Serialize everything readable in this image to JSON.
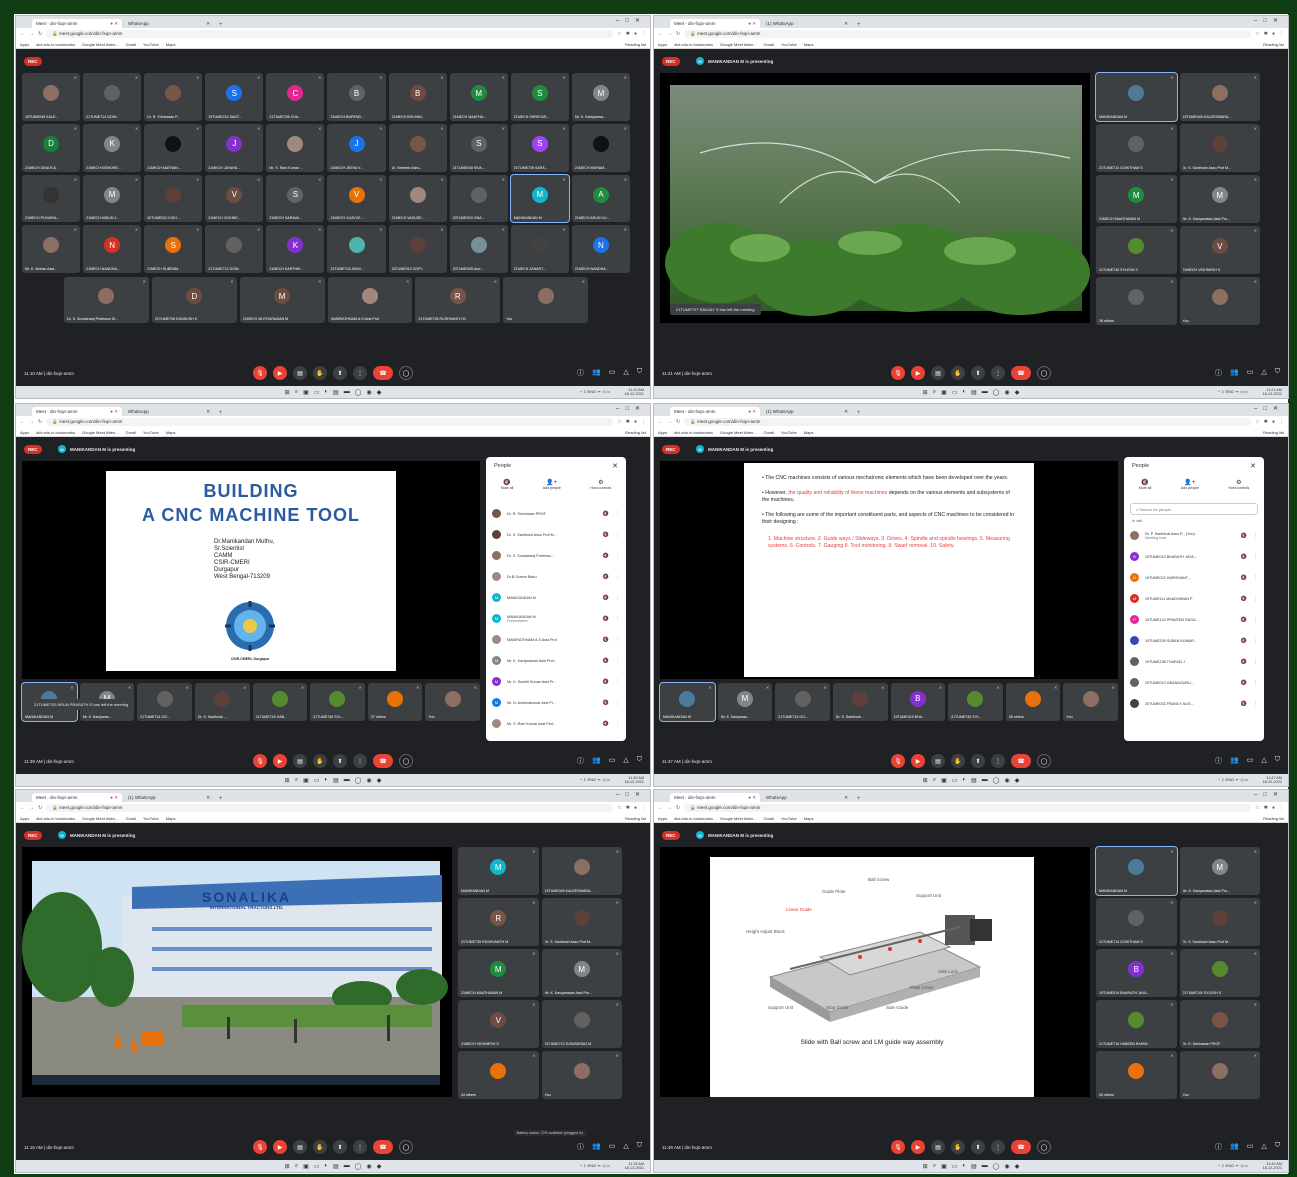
{
  "browser": {
    "tab_meet": "Meet - din-fxqn-amm",
    "tab_whatsapp": "WhatsApp",
    "tab_whatsapp_count": "(1) WhatsApp",
    "url": "meet.google.com/din-fxqn-amm",
    "bookmarks": [
      "Apps",
      "dict.edu.in bookmarks",
      "Google Meet Atten...",
      "Gmail",
      "YouTube",
      "Maps"
    ],
    "reading_list": "Reading list"
  },
  "meet": {
    "rec": "REC",
    "meeting_code": "din-fxqn-amm",
    "presenting": "MANIKANDAN M is presenting"
  },
  "panel1": {
    "time": "11:10 AM",
    "clock_time": "11:10 AM",
    "clock_date": "18-12-2021",
    "tiles": [
      {
        "n": "19TUME045 KALE...",
        "i": "",
        "c": "#8d6e63"
      },
      {
        "n": "21TUME714 GOW...",
        "i": "",
        "c": "#616161"
      },
      {
        "n": "Dr. R. Srinivasan P...",
        "i": "",
        "c": "#795548"
      },
      {
        "n": "19TUME210 SANT...",
        "i": "S",
        "c": "#1a73e8"
      },
      {
        "n": "21TUME706 CHA...",
        "i": "C",
        "c": "#e52592"
      },
      {
        "n": "21MECH BUPEND...",
        "i": "B",
        "c": "#5f6368"
      },
      {
        "n": "21MECH BHUVAN...",
        "i": "B",
        "c": "#6d4c41"
      },
      {
        "n": "21MECH MAATHA...",
        "i": "M",
        "c": "#1e8e3e"
      },
      {
        "n": "21MECH SHREYAS...",
        "i": "S",
        "c": "#1e8e3e"
      },
      {
        "n": "Mr. K. Kaviyarasa...",
        "i": "M",
        "c": "#80868b"
      },
      {
        "n": "21MECH DINA R.A.",
        "i": "D",
        "c": "#188038"
      },
      {
        "n": "21MECH KISHORE...",
        "i": "K",
        "c": "#80868b"
      },
      {
        "n": "21MECH MATHAN...",
        "i": "",
        "c": "#111"
      },
      {
        "n": "21MECH JAYAHA...",
        "i": "J",
        "c": "#8430ce"
      },
      {
        "n": "Mr. S. Ram Kumar ...",
        "i": "",
        "c": "#a1887f"
      },
      {
        "n": "21MECH JEEVA V...",
        "i": "J",
        "c": "#1a73e8"
      },
      {
        "n": "Dr. Neelesh Ashu...",
        "i": "",
        "c": "#795548"
      },
      {
        "n": "21TUME040 SIVA...",
        "i": "S",
        "c": "#5f6368"
      },
      {
        "n": "21TUME739 SARA...",
        "i": "S",
        "c": "#a142f4"
      },
      {
        "n": "21MECH MOHAM...",
        "i": "",
        "c": "#111"
      },
      {
        "n": "21MECH PUVIARA...",
        "i": "",
        "c": "#333"
      },
      {
        "n": "21MECH MIDUN J...",
        "i": "M",
        "c": "#80868b"
      },
      {
        "n": "20TUME022 KISH...",
        "i": "",
        "c": "#5d4037"
      },
      {
        "n": "21MECH VIGHNE...",
        "i": "V",
        "c": "#6d4c41"
      },
      {
        "n": "21MECH SARAVA...",
        "i": "S",
        "c": "#5f6368"
      },
      {
        "n": "21MECH VIJAYVE...",
        "i": "V",
        "c": "#e8710a"
      },
      {
        "n": "21MECH VASUDE...",
        "i": "",
        "c": "#a1887f"
      },
      {
        "n": "20TUME010 GNA...",
        "i": "",
        "c": "#616161"
      },
      {
        "n": "MANIKANDAN M",
        "i": "M",
        "c": "#12b5cb",
        "hl": true
      },
      {
        "n": "21MECH ARUN KU...",
        "i": "A",
        "c": "#1e8e3e"
      },
      {
        "n": "Mr. K. Mohan Asst...",
        "i": "",
        "c": "#8d6e63"
      },
      {
        "n": "21MECH NANDHA...",
        "i": "N",
        "c": "#d93025"
      },
      {
        "n": "21MECH SUBRAM...",
        "i": "S",
        "c": "#e8710a"
      },
      {
        "n": "21TUME713 GOW...",
        "i": "",
        "c": "#616161"
      },
      {
        "n": "21MECH KARTHIK...",
        "i": "K",
        "c": "#8430ce"
      },
      {
        "n": "21TUME704 ASWI...",
        "i": "",
        "c": "#4db6ac"
      },
      {
        "n": "20TUME010 GOPI...",
        "i": "",
        "c": "#5d4037"
      },
      {
        "n": "20TUME005 Asvi...",
        "i": "",
        "c": "#78909c"
      },
      {
        "n": "21MECH JANART...",
        "i": "",
        "c": "#424242"
      },
      {
        "n": "21MECH NANDHA...",
        "i": "N",
        "c": "#1a73e8"
      }
    ],
    "tiles_last": [
      {
        "n": "Dr. S. Sundararaj Professor M...",
        "i": "",
        "c": "#8d6e63"
      },
      {
        "n": "21TUME708 DHANUSH K",
        "i": "D",
        "c": "#6d4c41"
      },
      {
        "n": "21MECH MUTHURAMAN M",
        "i": "M",
        "c": "#6d4c41"
      },
      {
        "n": "MANIRATHNAM A.S Asst.Prof",
        "i": "",
        "c": "#a1887f"
      },
      {
        "n": "21TUME735 RUSHVANTH M",
        "i": "R",
        "c": "#795548"
      },
      {
        "n": "You",
        "i": "",
        "c": "#8d6e63"
      }
    ]
  },
  "panel2": {
    "time": "11:21 AM",
    "clock_time": "11:21 AM",
    "clock_date": "18-12-2021",
    "notice": "21TUME707 SANJAY S has left the meeting",
    "tiles": [
      {
        "n": "MANIKANDAN M",
        "i": "",
        "c": "#4e7a9a",
        "hl": true
      },
      {
        "n": "19TUME045 KALEESWARA...",
        "i": "",
        "c": "#8d6e63"
      },
      {
        "n": "21TUME714 GOWTHAM S",
        "i": "",
        "c": "#616161"
      },
      {
        "n": "Dr. S. Santhosh Asso Prof M...",
        "i": "",
        "c": "#5d4037"
      },
      {
        "n": "21MECH MAATHAVAN M",
        "i": "M",
        "c": "#1e8e3e"
      },
      {
        "n": "Mr. K. Kaviyarasan Asst Pro...",
        "i": "M",
        "c": "#80868b"
      },
      {
        "n": "21TUME745 SYLESH S",
        "i": "",
        "c": "#558b2f"
      },
      {
        "n": "21MECH VIGHNESH S",
        "i": "V",
        "c": "#6d4c41"
      },
      {
        "n": "26 others",
        "i": "",
        "c": "#5f6368"
      },
      {
        "n": "You",
        "i": "",
        "c": "#8d6e63"
      }
    ]
  },
  "panel3": {
    "time": "11:39 AM",
    "clock_time": "11:39 AM",
    "clock_date": "18-12-2021",
    "slide_title1": "BUILDING",
    "slide_title2": "A CNC MACHINE TOOL",
    "author": [
      "Dr.Manikandan Muthu,",
      "Sr.Scientist",
      "CAMM",
      "CSIR-CMERI",
      "Durgapur",
      "West Bengal-713209"
    ],
    "logo_caption": "CSIR-CMERI, Durgapur",
    "notice": "21TUME703 ARUN PRASATH S has left the meeting",
    "people_title": "People",
    "mute_all": "Mute all",
    "add_people": "Add people",
    "host_controls": "Host controls",
    "people": [
      {
        "n": "Dr. R. Srinivasan PROF",
        "c": "#795548"
      },
      {
        "n": "Dr. S. Santhosh Asso Prof M...",
        "c": "#5d4037"
      },
      {
        "n": "Dr. S. Sundararaj Professo...",
        "c": "#8d6e63"
      },
      {
        "n": "Dr.B.Suresh Babu",
        "c": "#a1887f"
      },
      {
        "n": "MANIKANDAN M",
        "c": "#12b5cb",
        "i": "M"
      },
      {
        "n": "MANIKANDAN M",
        "c": "#12b5cb",
        "i": "M",
        "sub": "Presentation"
      },
      {
        "n": "MANIRATHNAM A.S Asst.Prof",
        "c": "#a1887f"
      },
      {
        "n": "Mr. K. Kaviyarasan Asst Prof...",
        "c": "#80868b",
        "i": "M"
      },
      {
        "n": "Mr. K. Senthil Kumar Asst Pr...",
        "c": "#8430ce",
        "i": "M"
      },
      {
        "n": "Mr. N. Aravindkumar Asst Pr...",
        "c": "#1a73e8",
        "i": "M"
      },
      {
        "n": "Mr. S. Ram Kumar Asst Prof...",
        "c": "#a1887f"
      }
    ],
    "tiles": [
      {
        "n": "MANIKANDAN M",
        "i": "",
        "c": "#4e7a9a",
        "hl": true
      },
      {
        "n": "Mr. K. Kaviyaras...",
        "i": "M",
        "c": "#80868b"
      },
      {
        "n": "21TUME714 GO...",
        "i": "",
        "c": "#616161"
      },
      {
        "n": "Dr. S. Santhosh ...",
        "i": "",
        "c": "#5d4037"
      },
      {
        "n": "21TUME716 HAB...",
        "i": "",
        "c": "#558b2f"
      },
      {
        "n": "21TUME745 SYL...",
        "i": "",
        "c": "#558b2f"
      },
      {
        "n": "37 others",
        "i": "",
        "c": "#e8710a"
      },
      {
        "n": "You",
        "i": "",
        "c": "#8d6e63"
      }
    ]
  },
  "panel4": {
    "time": "11:47 AM",
    "clock_time": "11:47 AM",
    "clock_date": "18-12-2021",
    "bullet1": "The CNC machines consists of various mechatronic elements which have been developed over the years.",
    "bullet2a": "However, ",
    "bullet2b": "the quality and reliability of these machines",
    "bullet2c": " depends on the various elements and subsystems of the machines,",
    "bullet3": "The following are some of the important constituent parts, and aspects of CNC machines to be considered in their designing :",
    "parts": "1. Machine structure. 2. Guide ways / Slideways. 3. Drives. 4. Spindle and spindle bearings. 5. Measuring systems. 6. Controls. 7. Gauging 8. Tool monitoring. 9. Swarf removal. 10. Safety.",
    "people_title": "People",
    "mute_all": "Mute all",
    "add_people": "Add people",
    "host_controls": "Host controls",
    "search": "Search for people",
    "in_call": "In call",
    "people": [
      {
        "n": "Dr. P. Santhival Asso P... (You)",
        "c": "#8d6e63",
        "sub": "Meeting host"
      },
      {
        "n": "19TUME019 BHARATH JAYA...",
        "c": "#8430ce",
        "i": "B"
      },
      {
        "n": "19TUME022 HARISHANT...",
        "c": "#e8710a",
        "i": "H"
      },
      {
        "n": "19TUME111 MAADHAVAN P",
        "c": "#d93025",
        "i": "M"
      },
      {
        "n": "19TUME144 PRAVEEN RAGA...",
        "c": "#e52592",
        "i": "P"
      },
      {
        "n": "19TUME209 SUBAN KUMAR...",
        "c": "#3949ab",
        "i": ""
      },
      {
        "n": "19TUME238 THARUN J",
        "c": "#5f6368",
        "i": ""
      },
      {
        "n": "20TUME013 GNANAGURU...",
        "c": "#616161",
        "i": ""
      },
      {
        "n": "20TUME033 FRANCY AUG...",
        "c": "#424242",
        "i": ""
      }
    ],
    "tiles": [
      {
        "n": "MANIKANDAN M",
        "i": "",
        "c": "#4e7a9a",
        "hl": true
      },
      {
        "n": "Mr. K. Kaviyaras...",
        "i": "M",
        "c": "#80868b"
      },
      {
        "n": "21TUME714 GO...",
        "i": "",
        "c": "#616161"
      },
      {
        "n": "Dr. S. Santhosh ...",
        "i": "",
        "c": "#5d4037"
      },
      {
        "n": "19TUME019 BHA...",
        "i": "B",
        "c": "#8430ce"
      },
      {
        "n": "21TUME745 SYL...",
        "i": "",
        "c": "#558b2f"
      },
      {
        "n": "28 others",
        "i": "",
        "c": "#e8710a"
      },
      {
        "n": "You",
        "i": "",
        "c": "#8d6e63"
      }
    ]
  },
  "panel5": {
    "time": "11:15 AM",
    "clock_time": "11:15 AM",
    "clock_date": "18-12-2021",
    "sign_brand": "SONALIKA",
    "sign_sub": "INTERNATIONAL TRACTORS LTD.",
    "battery": "Battery status: 72% available (plugged in)",
    "tiles": [
      {
        "n": "MANIKANDAN M",
        "i": "M",
        "c": "#12b5cb"
      },
      {
        "n": "19TUME045 KALEESWARA...",
        "i": "",
        "c": "#8d6e63"
      },
      {
        "n": "21TUME735 RUSHVANTH M",
        "i": "R",
        "c": "#795548"
      },
      {
        "n": "Dr. S. Santhosh Asso Prof M...",
        "i": "",
        "c": "#5d4037"
      },
      {
        "n": "21MECH MAATHAVAN M",
        "i": "M",
        "c": "#1e8e3e"
      },
      {
        "n": "Mr. K. Kaviyarasan Asst Pro...",
        "i": "M",
        "c": "#80868b"
      },
      {
        "n": "21MECH VIGHNESH S",
        "i": "V",
        "c": "#6d4c41"
      },
      {
        "n": "21TUME710 GOWSIKRAJ M",
        "i": "",
        "c": "#616161"
      },
      {
        "n": "44 others",
        "i": "",
        "c": "#e8710a"
      },
      {
        "n": "You",
        "i": "",
        "c": "#8d6e63"
      }
    ]
  },
  "panel6": {
    "time": "11:49 AM",
    "clock_time": "11:49 AM",
    "clock_date": "18-12-2021",
    "caption": "Slide with Ball screw and LM guide way assembly",
    "labels": {
      "ball_screw": "Ball Screw",
      "guide_plate": "Guide Plate",
      "support_unit_top": "Support Unit",
      "linear_guide": "Linear Guide",
      "height_adjust": "Height Adjust Block",
      "side_lock": "Side Lock",
      "plate_cover": "Plate Cover",
      "support_unit": "Support Unit",
      "stop_guide": "Stop Guide",
      "side_guide": "Side Guide"
    },
    "tiles": [
      {
        "n": "MANIKANDAN M",
        "i": "",
        "c": "#4e7a9a",
        "hl": true
      },
      {
        "n": "Mr. K. Kaviyarasan Asst Pro...",
        "i": "M",
        "c": "#80868b"
      },
      {
        "n": "21TUME714 GOWTHAM S",
        "i": "",
        "c": "#616161"
      },
      {
        "n": "Dr. S. Santhosh Asso Prof M...",
        "i": "",
        "c": "#5d4037"
      },
      {
        "n": "19TUME019 BHARATH JAYA...",
        "i": "B",
        "c": "#8430ce"
      },
      {
        "n": "21TUME745 SYLESH S",
        "i": "",
        "c": "#558b2f"
      },
      {
        "n": "21TUME716 HABEEB RAHIM...",
        "i": "",
        "c": "#558b2f"
      },
      {
        "n": "Dr. R. Srinivasan PROF",
        "i": "",
        "c": "#795548"
      },
      {
        "n": "26 others",
        "i": "",
        "c": "#e8710a"
      },
      {
        "n": "You",
        "i": "",
        "c": "#8d6e63"
      }
    ]
  }
}
